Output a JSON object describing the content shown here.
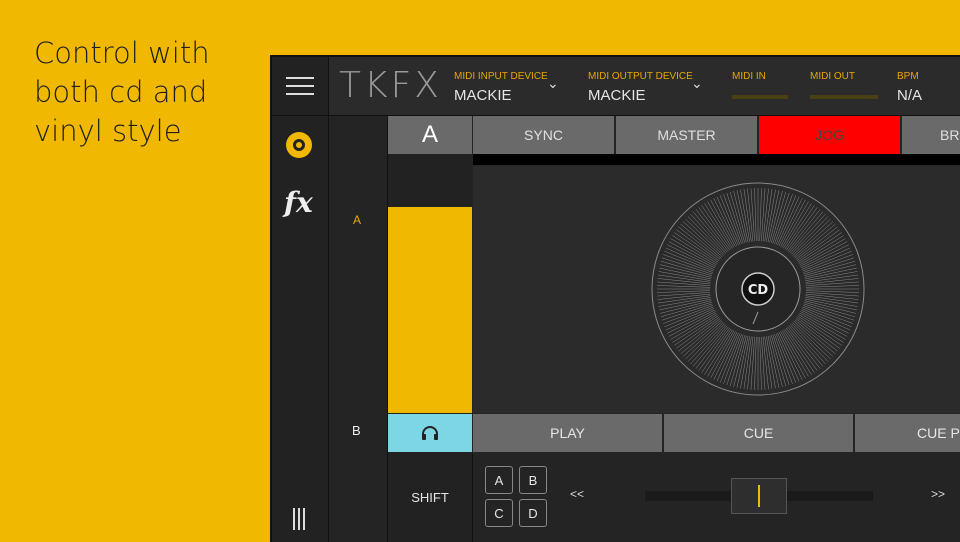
{
  "promo": {
    "caption": "Control with\nboth cd and\nvinyl style"
  },
  "header": {
    "logo": "TKFX",
    "midi_input_label": "MIDI INPUT DEVICE",
    "midi_input_value": "MACKIE",
    "midi_output_label": "MIDI OUTPUT DEVICE",
    "midi_output_value": "MACKIE",
    "midi_in_label": "MIDI IN",
    "midi_out_label": "MIDI OUT",
    "bpm_label": "BPM",
    "bpm_value": "N/A"
  },
  "sidebar": {
    "icons": [
      "menu-icon",
      "disc-icon",
      "fx-icon",
      "bars-icon"
    ],
    "fx_glyph": "fx"
  },
  "deck": {
    "letter": "A",
    "label_a": "A",
    "label_b": "B",
    "tabs": [
      "SYNC",
      "MASTER",
      "JOG",
      "BRO"
    ],
    "active_tab": "JOG",
    "volume_level": 0.8,
    "jog_label": "CD",
    "transport": [
      "PLAY",
      "CUE",
      "CUE PLAY"
    ],
    "shift_label": "SHIFT",
    "hotcues": [
      "A",
      "B",
      "C",
      "D"
    ],
    "nav_back": "<<",
    "nav_forward": ">>",
    "pitch_position": 0.5
  },
  "colors": {
    "accent": "#f0b800",
    "active": "#ff0000",
    "headphone": "#7dd6e4",
    "button": "#6a6a6a"
  }
}
